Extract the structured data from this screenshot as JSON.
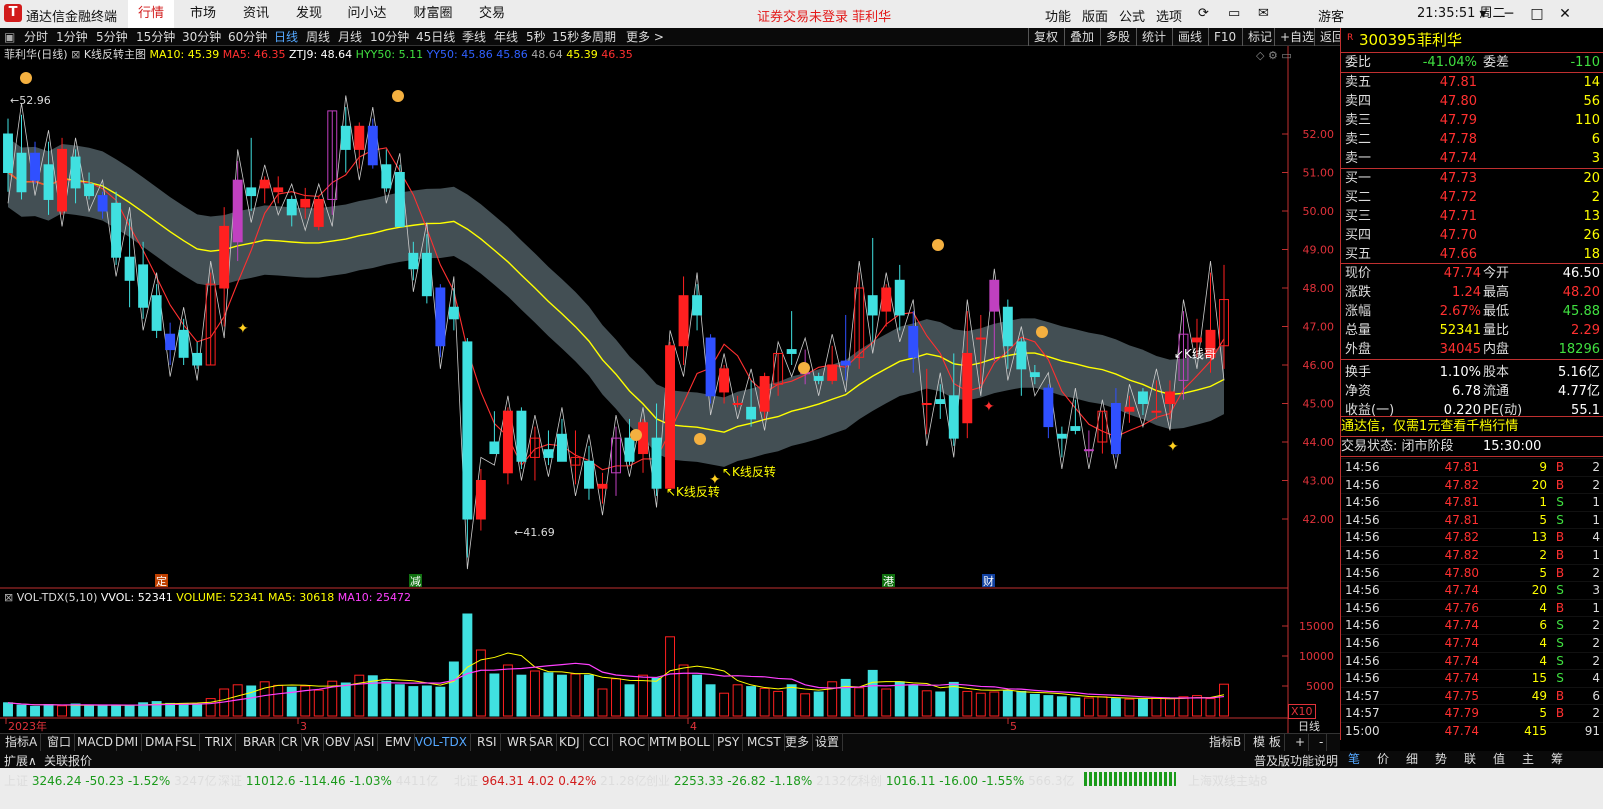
{
  "app": {
    "name": "通达信金融终端",
    "logo": "logo-icon"
  },
  "top_menu": [
    "行情",
    "市场",
    "资讯",
    "发现",
    "问小达",
    "财富圈",
    "交易"
  ],
  "notice": "证券交易未登录  菲利华",
  "right_menu": [
    "功能",
    "版面",
    "公式",
    "选项"
  ],
  "user": "游客",
  "clock": "21:35:51 周二",
  "periods": [
    "分时",
    "1分钟",
    "5分钟",
    "15分钟",
    "30分钟",
    "60分钟",
    "日线",
    "周线",
    "月线",
    "10分钟",
    "45日线",
    "季线",
    "年线",
    "5秒",
    "15秒",
    "多周期",
    "更多 >"
  ],
  "active_period": "日线",
  "toolbar_right": [
    "复权",
    "叠加",
    "多股",
    "统计",
    "画线",
    "F10",
    "标记",
    "+自选",
    "返回"
  ],
  "legend_main": {
    "title": "菲利华(日线)",
    "formula": "K线反转主图",
    "ma10": "MA10: 45.39",
    "ma5": "MA5: 46.35",
    "ztj": "ZTJ9: 48.64",
    "hyy": "HYY50: 5.11",
    "yy": "YY50: 45.86",
    "v1": "45.86",
    "v2": "48.64",
    "v3": "45.39",
    "v4": "46.35"
  },
  "legend_vol": {
    "name": "VOL-TDX(5,10)",
    "vvol": "VVOL: 52341",
    "volume": "VOLUME: 52341",
    "ma5": "MA5: 30618",
    "ma10": "MA10: 25472"
  },
  "annotations": {
    "high": "52.96",
    "low": "41.69",
    "kx1": "K线反转",
    "kx2": "K线反转",
    "kxg": "K线哥",
    "ding": "定",
    "jian": "减",
    "gang": "港",
    "cai": "财"
  },
  "x_labels": [
    "2023年",
    "3",
    "4",
    "5"
  ],
  "x_unit": "日线",
  "x10": "X10",
  "chart_data": {
    "type": "candlestick",
    "y_ticks": [
      52.0,
      51.0,
      50.0,
      49.0,
      48.0,
      47.0,
      46.0,
      45.0,
      44.0,
      43.0,
      42.0
    ],
    "vol_ticks": [
      15000,
      10000,
      5000
    ],
    "candles": [
      [
        52.0,
        52.4,
        50.5,
        51.0
      ],
      [
        51.5,
        52.5,
        50.3,
        50.5
      ],
      [
        51.5,
        51.8,
        50.7,
        50.8
      ],
      [
        51.2,
        51.8,
        49.9,
        50.3
      ],
      [
        50.0,
        51.9,
        49.9,
        51.6
      ],
      [
        51.4,
        51.6,
        50.2,
        50.6
      ],
      [
        50.7,
        51.0,
        50.3,
        50.4
      ],
      [
        50.4,
        50.5,
        49.8,
        50.0
      ],
      [
        50.2,
        50.5,
        48.6,
        48.8
      ],
      [
        48.8,
        49.8,
        47.5,
        48.2
      ],
      [
        48.6,
        49.2,
        47.2,
        47.5
      ],
      [
        47.8,
        48.1,
        46.7,
        46.9
      ],
      [
        46.8,
        47.1,
        46.0,
        46.4
      ],
      [
        46.9,
        47.2,
        46.0,
        46.2
      ],
      [
        46.3,
        46.6,
        45.9,
        46.0
      ],
      [
        46.0,
        48.4,
        46.0,
        48.1
      ],
      [
        48.0,
        50.1,
        47.0,
        49.6
      ],
      [
        49.2,
        51.3,
        48.7,
        50.8
      ],
      [
        50.6,
        51.9,
        50.0,
        50.4
      ],
      [
        50.6,
        50.9,
        50.2,
        50.8
      ],
      [
        50.5,
        50.9,
        50.2,
        50.6
      ],
      [
        50.3,
        50.4,
        49.6,
        49.9
      ],
      [
        50.1,
        50.6,
        49.8,
        50.3
      ],
      [
        49.6,
        50.4,
        49.5,
        50.3
      ],
      [
        50.3,
        52.6,
        49.9,
        52.6
      ],
      [
        52.2,
        52.7,
        51.0,
        51.6
      ],
      [
        51.6,
        52.3,
        51.1,
        52.2
      ],
      [
        52.2,
        52.4,
        51.1,
        51.2
      ],
      [
        51.2,
        51.6,
        50.5,
        50.6
      ],
      [
        51.0,
        51.2,
        49.6,
        49.6
      ],
      [
        48.9,
        49.2,
        48.2,
        48.5
      ],
      [
        48.9,
        49.4,
        47.6,
        47.8
      ],
      [
        48.0,
        48.1,
        46.2,
        46.5
      ],
      [
        47.5,
        48.0,
        46.9,
        47.2
      ],
      [
        46.6,
        46.7,
        41.0,
        42.0
      ],
      [
        42.0,
        43.3,
        41.7,
        43.0
      ],
      [
        44.0,
        44.8,
        43.7,
        43.7
      ],
      [
        43.2,
        44.9,
        42.9,
        44.8
      ],
      [
        44.8,
        44.9,
        43.3,
        43.5
      ],
      [
        43.6,
        44.4,
        43.0,
        44.1
      ],
      [
        43.8,
        44.3,
        43.4,
        43.6
      ],
      [
        44.2,
        44.6,
        43.5,
        43.5
      ],
      [
        43.4,
        44.3,
        42.9,
        43.6
      ],
      [
        43.5,
        43.9,
        42.5,
        42.8
      ],
      [
        42.8,
        43.2,
        42.4,
        42.9
      ],
      [
        43.2,
        44.4,
        42.6,
        44.1
      ],
      [
        44.1,
        44.6,
        43.4,
        43.5
      ],
      [
        43.7,
        44.6,
        43.2,
        44.5
      ],
      [
        44.1,
        45.0,
        42.6,
        42.8
      ],
      [
        42.8,
        46.6,
        42.7,
        46.5
      ],
      [
        46.5,
        48.3,
        46.0,
        47.8
      ],
      [
        47.8,
        48.1,
        46.9,
        47.3
      ],
      [
        46.7,
        46.8,
        45.0,
        45.2
      ],
      [
        45.3,
        46.0,
        45.0,
        45.9
      ],
      [
        45.0,
        45.2,
        44.9,
        45.0
      ],
      [
        44.9,
        45.6,
        44.4,
        44.6
      ],
      [
        44.8,
        45.8,
        44.6,
        45.7
      ],
      [
        45.5,
        46.3,
        45.2,
        46.3
      ],
      [
        46.4,
        47.4,
        46.0,
        46.3
      ],
      [
        45.8,
        46.4,
        45.5,
        45.8
      ],
      [
        45.7,
        45.8,
        45.5,
        45.6
      ],
      [
        45.6,
        46.5,
        45.5,
        46.0
      ],
      [
        46.1,
        47.3,
        45.6,
        46.0
      ],
      [
        46.2,
        48.4,
        45.9,
        48.0
      ],
      [
        47.8,
        49.3,
        46.6,
        47.3
      ],
      [
        47.4,
        48.1,
        47.0,
        48.0
      ],
      [
        48.2,
        48.6,
        46.9,
        47.3
      ],
      [
        47.0,
        47.4,
        45.8,
        46.2
      ],
      [
        45.0,
        45.9,
        44.2,
        45.0
      ],
      [
        45.1,
        45.5,
        44.6,
        45.0
      ],
      [
        45.2,
        46.3,
        43.9,
        44.1
      ],
      [
        44.5,
        47.4,
        44.1,
        46.3
      ],
      [
        46.7,
        47.3,
        45.5,
        46.7
      ],
      [
        47.4,
        48.2,
        46.1,
        48.2
      ],
      [
        47.5,
        47.7,
        45.9,
        46.5
      ],
      [
        46.6,
        46.7,
        45.2,
        45.9
      ],
      [
        45.8,
        46.0,
        45.5,
        45.7
      ],
      [
        45.4,
        45.5,
        44.1,
        44.4
      ],
      [
        44.2,
        44.4,
        43.6,
        44.1
      ],
      [
        44.4,
        45.1,
        44.2,
        44.3
      ],
      [
        43.8,
        44.3,
        43.6,
        43.8
      ],
      [
        44.0,
        44.8,
        43.7,
        44.8
      ],
      [
        45.0,
        45.4,
        43.6,
        43.7
      ],
      [
        44.8,
        45.2,
        44.5,
        44.9
      ],
      [
        45.3,
        45.4,
        44.7,
        45.0
      ],
      [
        44.8,
        45.6,
        44.6,
        44.8
      ],
      [
        45.0,
        45.6,
        44.6,
        45.3
      ],
      [
        45.6,
        47.4,
        45.1,
        46.8
      ],
      [
        46.6,
        47.2,
        46.2,
        46.7
      ],
      [
        46.2,
        48.4,
        45.8,
        46.9
      ],
      [
        46.5,
        48.6,
        45.9,
        47.7
      ]
    ],
    "volumes": [
      2200,
      1800,
      1600,
      1900,
      1700,
      2000,
      1800,
      1700,
      1800,
      1700,
      2200,
      2400,
      2100,
      2100,
      2000,
      2900,
      4500,
      5200,
      5000,
      5700,
      5100,
      4800,
      5000,
      4300,
      5800,
      5500,
      6800,
      6700,
      5800,
      5200,
      4900,
      5000,
      4800,
      9000,
      17000,
      11000,
      7000,
      8500,
      6800,
      7500,
      7200,
      6800,
      7000,
      6800,
      4500,
      6200,
      5200,
      6800,
      6300,
      13200,
      8500,
      6800,
      5200,
      3800,
      5200,
      4900,
      4600,
      4100,
      5200,
      3700,
      4000,
      5700,
      6100,
      4700,
      7600,
      4500,
      5700,
      5100,
      4200,
      4000,
      5600,
      4100,
      3800,
      4000,
      4200,
      4100,
      3600,
      3400,
      3200,
      3000,
      3000,
      3200,
      2900,
      2800,
      2800,
      3000,
      2900,
      3200,
      3400,
      2900,
      5300
    ]
  },
  "quote": {
    "code": "300395",
    "name": "菲利华",
    "tag": "R",
    "weibi_label": "委比",
    "weibi": "-41.04%",
    "weicha_label": "委差",
    "weicha": "-110",
    "sell": [
      {
        "l": "卖五",
        "p": "47.81",
        "v": "14"
      },
      {
        "l": "卖四",
        "p": "47.80",
        "v": "56"
      },
      {
        "l": "卖三",
        "p": "47.79",
        "v": "110"
      },
      {
        "l": "卖二",
        "p": "47.78",
        "v": "6"
      },
      {
        "l": "卖一",
        "p": "47.74",
        "v": "3"
      }
    ],
    "buy": [
      {
        "l": "买一",
        "p": "47.73",
        "v": "20"
      },
      {
        "l": "买二",
        "p": "47.72",
        "v": "2"
      },
      {
        "l": "买三",
        "p": "47.71",
        "v": "13"
      },
      {
        "l": "买四",
        "p": "47.70",
        "v": "26"
      },
      {
        "l": "买五",
        "p": "47.66",
        "v": "18"
      }
    ],
    "stats": [
      {
        "l": "现价",
        "v": "47.74",
        "l2": "今开",
        "v2": "46.50",
        "c": "#ff3030",
        "c2": "#ffffff"
      },
      {
        "l": "涨跌",
        "v": "1.24",
        "l2": "最高",
        "v2": "48.20",
        "c": "#ff3030",
        "c2": "#ff3030"
      },
      {
        "l": "涨幅",
        "v": "2.67%",
        "l2": "最低",
        "v2": "45.88",
        "c": "#ff3030",
        "c2": "#40e040"
      },
      {
        "l": "总量",
        "v": "52341",
        "l2": "量比",
        "v2": "2.29",
        "c": "#ffff00",
        "c2": "#ff3030"
      },
      {
        "l": "外盘",
        "v": "34045",
        "l2": "内盘",
        "v2": "18296",
        "c": "#ff3030",
        "c2": "#40e040"
      },
      {
        "l": "换手",
        "v": "1.10%",
        "l2": "股本",
        "v2": "5.16亿",
        "c": "#ffffff",
        "c2": "#ffffff"
      },
      {
        "l": "净资",
        "v": "6.78",
        "l2": "流通",
        "v2": "4.77亿",
        "c": "#ffffff",
        "c2": "#ffffff"
      },
      {
        "l": "收益(一)",
        "v": "0.220",
        "l2": "PE(动)",
        "v2": "55.1",
        "c": "#ffffff",
        "c2": "#ffffff"
      }
    ],
    "promo": "通达信，仅需1元查看千档行情",
    "status_label": "交易状态: 闭市阶段",
    "status_time": "15:30:00"
  },
  "trades": [
    {
      "t": "14:56",
      "p": "47.81",
      "v": "9",
      "s": "B",
      "n": "2"
    },
    {
      "t": "14:56",
      "p": "47.82",
      "v": "20",
      "s": "B",
      "n": "2"
    },
    {
      "t": "14:56",
      "p": "47.81",
      "v": "1",
      "s": "S",
      "n": "1"
    },
    {
      "t": "14:56",
      "p": "47.81",
      "v": "5",
      "s": "S",
      "n": "1"
    },
    {
      "t": "14:56",
      "p": "47.82",
      "v": "13",
      "s": "B",
      "n": "4"
    },
    {
      "t": "14:56",
      "p": "47.82",
      "v": "2",
      "s": "B",
      "n": "1"
    },
    {
      "t": "14:56",
      "p": "47.80",
      "v": "5",
      "s": "B",
      "n": "2"
    },
    {
      "t": "14:56",
      "p": "47.74",
      "v": "20",
      "s": "S",
      "n": "3"
    },
    {
      "t": "14:56",
      "p": "47.76",
      "v": "4",
      "s": "B",
      "n": "1"
    },
    {
      "t": "14:56",
      "p": "47.74",
      "v": "6",
      "s": "S",
      "n": "2"
    },
    {
      "t": "14:56",
      "p": "47.74",
      "v": "4",
      "s": "S",
      "n": "2"
    },
    {
      "t": "14:56",
      "p": "47.74",
      "v": "4",
      "s": "S",
      "n": "2"
    },
    {
      "t": "14:56",
      "p": "47.74",
      "v": "15",
      "s": "S",
      "n": "4"
    },
    {
      "t": "14:57",
      "p": "47.75",
      "v": "49",
      "s": "B",
      "n": "6"
    },
    {
      "t": "14:57",
      "p": "47.79",
      "v": "5",
      "s": "B",
      "n": "2"
    },
    {
      "t": "15:00",
      "p": "47.74",
      "v": "415",
      "s": "",
      "n": "91"
    }
  ],
  "indicator_tabs": [
    "指标A",
    "窗口",
    "MACD",
    "DMI",
    "DMA",
    "FSL",
    "TRIX",
    "BRAR",
    "CR",
    "VR",
    "OBV",
    "ASI",
    "EMV",
    "VOL-TDX",
    "RSI",
    "WR",
    "SAR",
    "KDJ",
    "CCI",
    "ROC",
    "MTM",
    "BOLL",
    "PSY",
    "MCST",
    "更多",
    "设置"
  ],
  "active_indicator": "VOL-TDX",
  "indicator_right": [
    "指标B",
    "模 板",
    "+",
    "-"
  ],
  "expand_items": [
    "扩展∧",
    "关联报价"
  ],
  "right_tabs": [
    "笔",
    "价",
    "细",
    "势",
    "联",
    "值",
    "主",
    "筹"
  ],
  "status": {
    "sh": {
      "n": "上证",
      "v": "3246.24",
      "c": "-50.23",
      "p": "-1.52%",
      "a": "3247亿"
    },
    "sz": {
      "n": "深证",
      "v": "11012.6",
      "c": "-114.46",
      "p": "-1.03%",
      "a": "4411亿"
    },
    "bz": {
      "n": "北证",
      "v": "964.31",
      "c": "4.02",
      "p": "0.42%",
      "a": "21.28亿"
    },
    "cy": {
      "n": "创业",
      "v": "2253.33",
      "c": "-26.82",
      "p": "-1.18%",
      "a": "2132亿"
    },
    "kc": {
      "n": "科创",
      "v": "1016.11",
      "c": "-16.00",
      "p": "-1.55%",
      "a": "566.3亿"
    },
    "station": "上海双线主站8",
    "hint": "普及版功能说明"
  },
  "colors": {
    "up": "#ff3030",
    "down": "#40e0e0",
    "accent": "#d21c1c",
    "ma5": "#ff3030",
    "ma10": "#ffff00",
    "vol_ma10": "#ff40ff"
  }
}
